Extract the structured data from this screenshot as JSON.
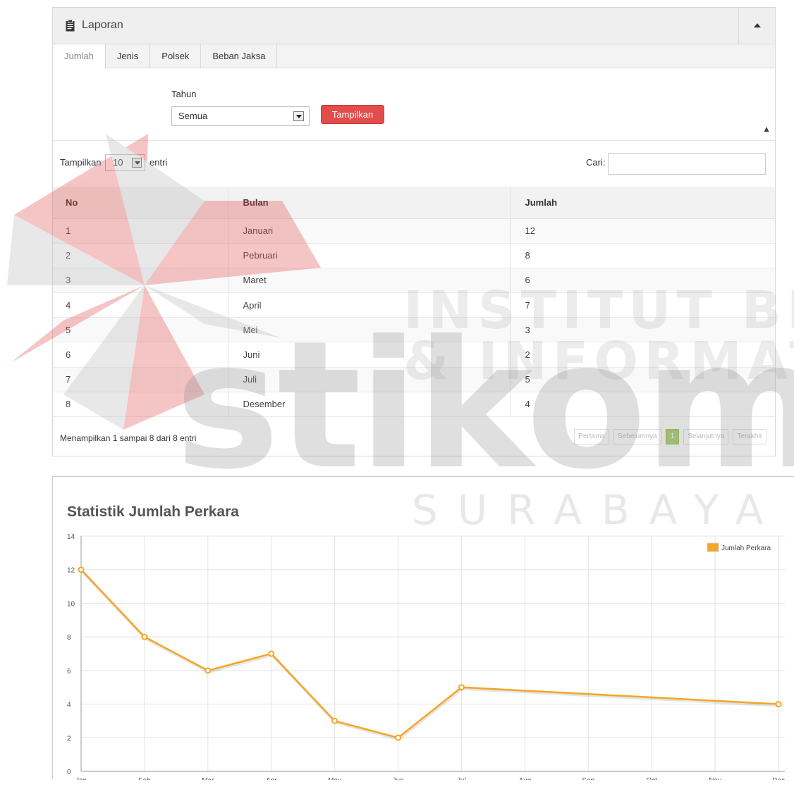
{
  "panel": {
    "title": "Laporan",
    "tabs": [
      "Jumlah",
      "Jenis",
      "Polsek",
      "Beban Jaksa"
    ],
    "active_tab": "Jumlah"
  },
  "filter": {
    "label": "Tahun",
    "selected": "Semua",
    "button_label": "Tampilkan"
  },
  "datatable": {
    "length_prefix": "Tampilkan",
    "length_value": "10",
    "length_suffix": "entri",
    "search_label": "Cari:",
    "search_value": "",
    "headers": [
      "No",
      "Bulan",
      "Jumlah"
    ],
    "rows": [
      [
        "1",
        "Januari",
        "12"
      ],
      [
        "2",
        "Pebruari",
        "8"
      ],
      [
        "3",
        "Maret",
        "6"
      ],
      [
        "4",
        "April",
        "7"
      ],
      [
        "5",
        "Mei",
        "3"
      ],
      [
        "6",
        "Juni",
        "2"
      ],
      [
        "7",
        "Juli",
        "5"
      ],
      [
        "8",
        "Desember",
        "4"
      ]
    ],
    "info": "Menampilkan 1 sampai 8 dari 8 entri",
    "pagination": [
      "Pertama",
      "Sebelumnya",
      "1",
      "Selanjutnya",
      "Terakhir"
    ],
    "current_page": "1"
  },
  "watermark": {
    "line1": "INSTITUT BISNIS",
    "line2": "& INFORMATIKA",
    "logo": "stikom",
    "city": "SURABAYA",
    "colors": [
      "#e24c4b",
      "#b9b9b9"
    ]
  },
  "chart_data": {
    "type": "line",
    "title": "Statistik Jumlah Perkara",
    "categories": [
      "Jan",
      "Feb",
      "Mar",
      "Apr",
      "May",
      "Jun",
      "Jul",
      "Aug",
      "Sep",
      "Oct",
      "Nov",
      "Dec"
    ],
    "series": [
      {
        "name": "Jumlah Perkara",
        "color": "#f5a623",
        "points": [
          {
            "x": "Jan",
            "y": 12
          },
          {
            "x": "Feb",
            "y": 8
          },
          {
            "x": "Mar",
            "y": 6
          },
          {
            "x": "Apr",
            "y": 7
          },
          {
            "x": "May",
            "y": 3
          },
          {
            "x": "Jun",
            "y": 2
          },
          {
            "x": "Jul",
            "y": 5
          },
          {
            "x": "Dec",
            "y": 4
          }
        ]
      }
    ],
    "yticks": [
      0,
      2,
      4,
      6,
      8,
      10,
      12,
      14
    ],
    "ylim": [
      0,
      14
    ],
    "grid": true,
    "legend": "top-right"
  }
}
